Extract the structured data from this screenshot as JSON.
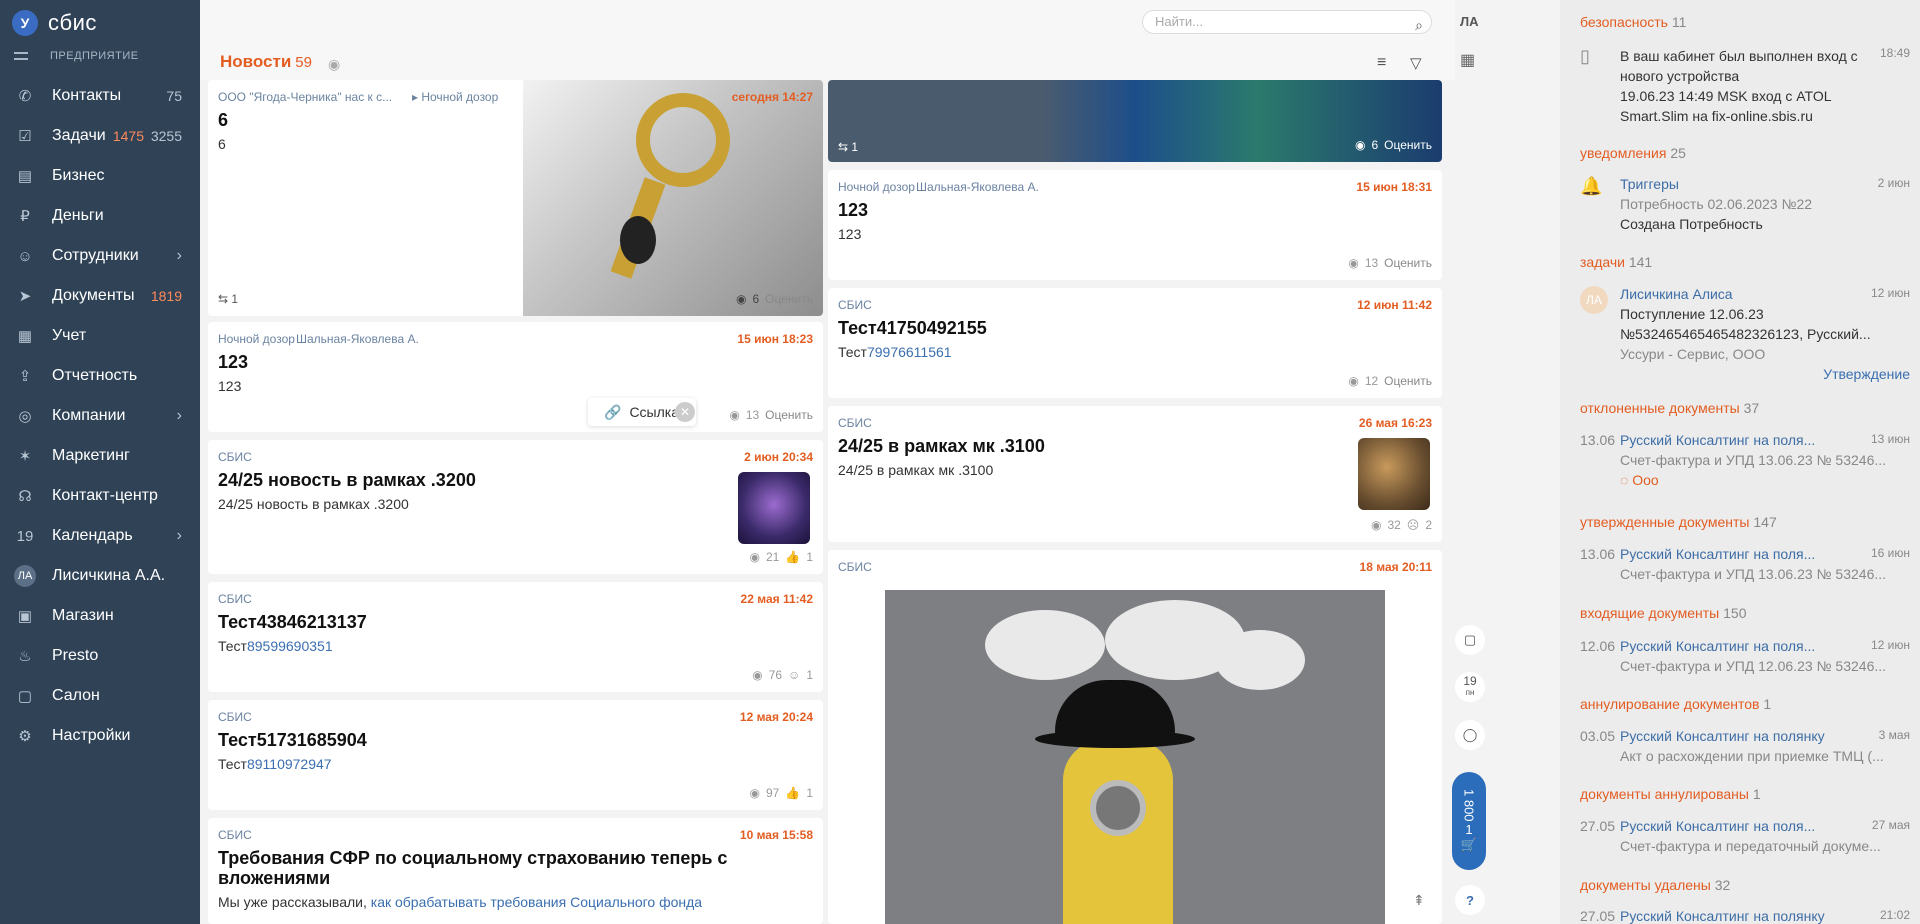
{
  "app": {
    "logo_text": "сбис",
    "org_label": "ПРЕДПРИЯТИЕ",
    "logo_mark": "У"
  },
  "nav": [
    {
      "label": "Контакты",
      "count": "75",
      "icon": "contacts-icon"
    },
    {
      "label": "Задачи",
      "count": "3255",
      "count_red": "1475",
      "icon": "tasks-icon"
    },
    {
      "label": "Бизнес",
      "icon": "business-icon"
    },
    {
      "label": "Деньги",
      "icon": "money-icon"
    },
    {
      "label": "Сотрудники",
      "chevron": "›",
      "icon": "staff-icon"
    },
    {
      "label": "Документы",
      "count_red": "1819",
      "icon": "documents-icon"
    },
    {
      "label": "Учет",
      "icon": "accounting-icon"
    },
    {
      "label": "Отчетность",
      "icon": "reports-icon"
    },
    {
      "label": "Компании",
      "chevron": "›",
      "icon": "companies-icon"
    },
    {
      "label": "Маркетинг",
      "icon": "marketing-icon"
    },
    {
      "label": "Контакт-центр",
      "icon": "contact-center-icon"
    },
    {
      "label": "Календарь",
      "chevron": "›",
      "icon": "calendar-icon",
      "badge": "19"
    },
    {
      "label": "Лисичкина А.А.",
      "avatar": "ЛА"
    },
    {
      "label": "Магазин",
      "icon": "shop-icon"
    },
    {
      "label": "Presto",
      "icon": "presto-icon"
    },
    {
      "label": "Салон",
      "icon": "salon-icon"
    },
    {
      "label": "Настройки",
      "icon": "settings-icon"
    }
  ],
  "header": {
    "search_placeholder": "Найти...",
    "title": "Новости",
    "count": "59",
    "user_initials": "ЛА"
  },
  "cards_left": [
    {
      "src": "ООО \"Ягода-Черника\" нас к с...",
      "src2": "Ночной дозор",
      "date": "сегодня 14:27",
      "title": "6",
      "body": "6",
      "reposts": "1",
      "views": "6",
      "rate": "Оценить"
    },
    {
      "src": "Ночной дозор",
      "src2": "Шальная-Яковлева А.",
      "date": "15 июн 18:23",
      "title": "123",
      "body": "123",
      "views": "13",
      "rate": "Оценить"
    },
    {
      "src": "СБИС",
      "date": "2 июн 20:34",
      "title": "24/25 новость в рамках .3200",
      "body": "24/25 новость в рамках .3200",
      "views": "21",
      "likes": "1"
    },
    {
      "src": "СБИС",
      "date": "22 мая 11:42",
      "title": "Тест43846213137",
      "body": "Тест",
      "body_link": "89599690351",
      "views": "76",
      "likes": "1"
    },
    {
      "src": "СБИС",
      "date": "12 мая 20:24",
      "title": "Тест51731685904",
      "body": "Тест",
      "body_link": "89110972947",
      "views": "97",
      "likes": "1"
    },
    {
      "src": "СБИС",
      "date": "10 мая 15:58",
      "title": "Требования СФР по социальному страхованию теперь с вложениями",
      "body": "Мы уже рассказывали, ",
      "body_link": "как обрабатывать требования Социального фонда"
    }
  ],
  "cards_right": [
    {
      "reposts": "1",
      "views": "6",
      "rate": "Оценить"
    },
    {
      "src": "Ночной дозор",
      "src2": "Шальная-Яковлева А.",
      "date": "15 июн 18:31",
      "title": "123",
      "body": "123",
      "views": "13",
      "rate": "Оценить"
    },
    {
      "src": "СБИС",
      "date": "12 июн 11:42",
      "title": "Тест41750492155",
      "body": "Тест",
      "body_link": "79976611561",
      "views": "12",
      "rate": "Оценить"
    },
    {
      "src": "СБИС",
      "date": "26 мая 16:23",
      "title": "24/25 в рамках мк .3100",
      "body": "24/25 в рамках мк .3100",
      "views": "32",
      "likes": "2"
    },
    {
      "src": "СБИС",
      "date": "18 мая 20:11"
    }
  ],
  "popup": {
    "label": "Ссылка"
  },
  "rail": {
    "calendar_day": "19",
    "calendar_dow": "пн",
    "cart_amount": "1 800",
    "cart_count": "1",
    "help": "?"
  },
  "right": {
    "security": {
      "title": "безопасность",
      "count": "11",
      "time": "18:49",
      "text": "В ваш кабинет был выполнен вход с нового устройства",
      "text2": "19.06.23 14:49 MSK вход с ATOL Smart.Slim на fix-online.sbis.ru"
    },
    "notify": {
      "title": "уведомления",
      "count": "25",
      "name": "Триггеры",
      "date": "2 июн",
      "sub": "Потребность 02.06.2023 №22",
      "sub2": "Создана Потребность"
    },
    "tasks": {
      "title": "задачи",
      "count": "141",
      "name": "Лисичкина Алиса",
      "date": "12 июн",
      "sub": "Поступление 12.06.23",
      "sub2": "№53246546546548232612З, Русский...",
      "sub3": "Уссури - Сервис, ООО",
      "action": "Утверждение",
      "initials": "ЛА"
    },
    "rejected": {
      "title": "отклоненные документы",
      "count": "37",
      "dt": "13.06",
      "t": "Русский Консалтинг на поля...",
      "d2": "13 июн",
      "t2": "Счет-фактура и УПД 13.06.23 № 53246...",
      "note": "Ооо"
    },
    "approved": {
      "title": "утвержденные документы",
      "count": "147",
      "dt": "13.06",
      "t": "Русский Консалтинг на поля...",
      "d2": "16 июн",
      "t2": "Счет-фактура и УПД 13.06.23 № 53246..."
    },
    "incoming": {
      "title": "входящие документы",
      "count": "150",
      "dt": "12.06",
      "t": "Русский Консалтинг на поля...",
      "d2": "12 июн",
      "t2": "Счет-фактура и УПД 12.06.23 № 53246..."
    },
    "annulment": {
      "title": "аннулирование документов",
      "count": "1",
      "dt": "03.05",
      "t": "Русский Консалтинг на полянку",
      "d2": "3 мая",
      "t2": "Акт о расхождении при приемке ТМЦ (..."
    },
    "annulled": {
      "title": "документы аннулированы",
      "count": "1",
      "dt": "27.05",
      "t": "Русский Консалтинг на поля...",
      "d2": "27 мая",
      "t2": "Счет-фактура и передаточный докуме..."
    },
    "deleted": {
      "title": "документы удалены",
      "count": "32",
      "dt": "27.05",
      "t": "Русский Консалтинг на полянку",
      "d2": "21:02"
    }
  }
}
